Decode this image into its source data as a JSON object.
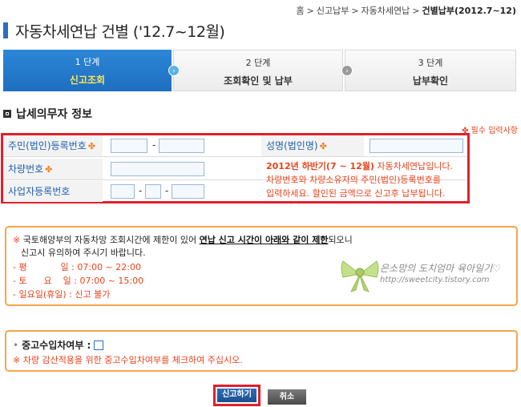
{
  "breadcrumb": {
    "items": [
      "홈",
      "신고납부",
      "자동차세연납"
    ],
    "current": "건별납부(2012.7~12)",
    "separator": ">"
  },
  "page_title": "자동차세연납 건별 ('12.7~12월)",
  "steps": [
    {
      "num": "1 단계",
      "label": "신고조회"
    },
    {
      "num": "2 단계",
      "label": "조회확인 및 납부"
    },
    {
      "num": "3 단계",
      "label": "납부확인"
    }
  ],
  "section_title": "납세의무자 정보",
  "required_note": "✤ 필수 입력사항",
  "form": {
    "resident_id_label": "주민(법인)등록번호",
    "name_label": "성명(법인명)",
    "car_number_label": "차량번호",
    "business_id_label": "사업자등록번호",
    "dash": "-",
    "required_mark": "✤",
    "notice_line1_hl": "2012년 하반기(7 ~ 12월)",
    "notice_line1_rest": " 자동차세연납입니다.",
    "notice_line2": "차량번호와 차량소유자의 주민(법인)등록번호를",
    "notice_line3": "입력하세요. 할인된 금액으로 신고후 납부됩니다."
  },
  "info": {
    "mark": "※",
    "line1_a": "국토해양부의 자동차망 조회시간에 제한이 있어 ",
    "line1_u": "연납 신고 시간이 아래와 같이 제한",
    "line1_b": "되오니",
    "line2": "신고시 유의하여 주시기 바랍니다.",
    "weekday": "- 평            일 : 07:00 ~ 22:00",
    "saturday": "- 토      요    일 : 07:00 ~ 15:00",
    "sunday": "- 일요일(휴일) : 신고 불가"
  },
  "watermark": {
    "line1": "은소망의 도치엄마 육아일기♡",
    "line2": "http://sweetcity.tistory.com"
  },
  "used_car": {
    "bullet": "•",
    "question": "중고수입차여부 :",
    "desc": "※ 차량 감산적용을 위한 중고수입차여부를 체크하여 주십시오."
  },
  "buttons": {
    "submit": "신고하기",
    "cancel": "취소"
  },
  "colors": {
    "accent_blue": "#2a6ebf",
    "highlight_red": "#e0202c",
    "notice_orange": "#e8431c",
    "box_border": "#f5a64a"
  }
}
